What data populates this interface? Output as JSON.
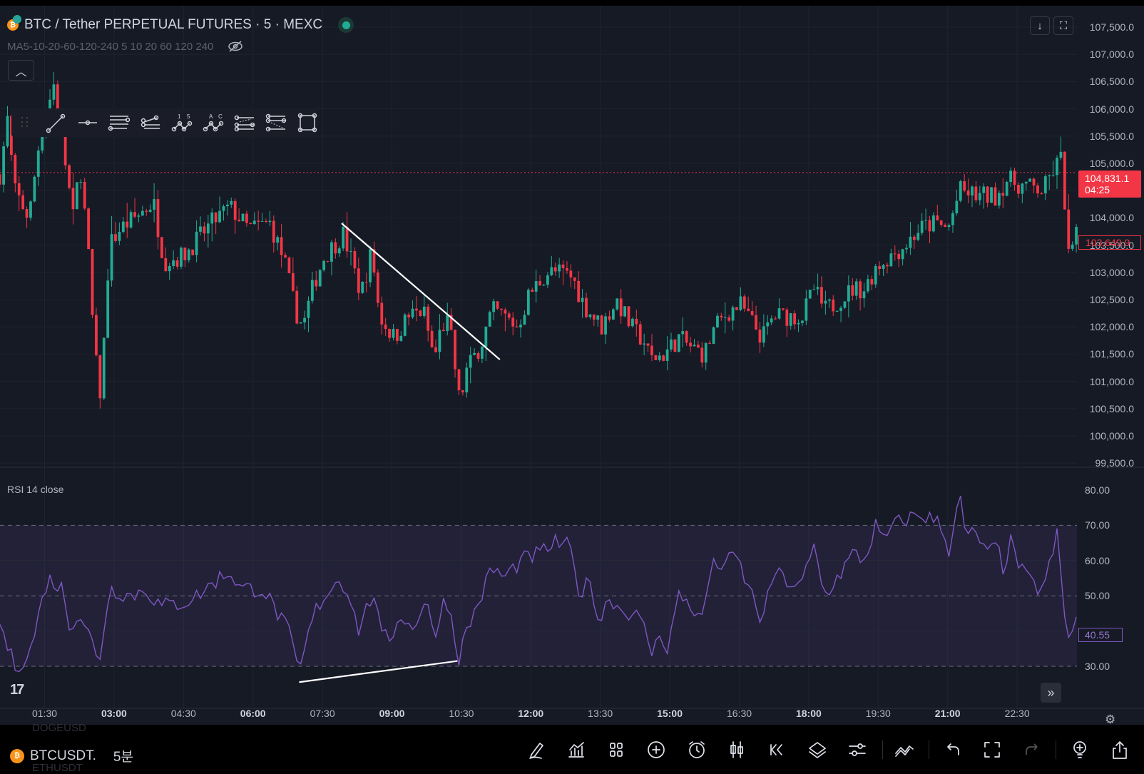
{
  "header": {
    "title": "BTC / Tether PERPETUAL FUTURES · 5 · MEXC",
    "indicator": "MA5-10-20-60-120-240 5 10 20 60 120 240"
  },
  "price_axis": [
    "107,500.0",
    "107,000.0",
    "106,500.0",
    "106,000.0",
    "105,500.0",
    "105,000.0",
    "104,500.0",
    "104,000.0",
    "103,500.0",
    "103,000.0",
    "102,500.0",
    "102,000.0",
    "101,500.0",
    "101,000.0",
    "100,500.0",
    "100,000.0",
    "99,500.0"
  ],
  "current_price": {
    "value": "104,831.1",
    "countdown": "04:25"
  },
  "last_price": "103,649.9",
  "rsi": {
    "title": "RSI 14 close",
    "axis": [
      "80.00",
      "70.00",
      "60.00",
      "50.00",
      "30.00"
    ],
    "value": "40.55"
  },
  "time_axis": [
    {
      "t": "01:30",
      "bold": false
    },
    {
      "t": "03:00",
      "bold": true
    },
    {
      "t": "04:30",
      "bold": false
    },
    {
      "t": "06:00",
      "bold": true
    },
    {
      "t": "07:30",
      "bold": false
    },
    {
      "t": "09:00",
      "bold": true
    },
    {
      "t": "10:30",
      "bold": false
    },
    {
      "t": "12:00",
      "bold": true
    },
    {
      "t": "13:30",
      "bold": false
    },
    {
      "t": "15:00",
      "bold": true
    },
    {
      "t": "16:30",
      "bold": false
    },
    {
      "t": "18:00",
      "bold": true
    },
    {
      "t": "19:30",
      "bold": false
    },
    {
      "t": "21:00",
      "bold": true
    },
    {
      "t": "22:30",
      "bold": false
    }
  ],
  "bottom": {
    "symbol": "BTCUSDT.",
    "interval": "5분",
    "prev_symbol": "DOGEUSD",
    "next_symbol": "ETHUSDT"
  },
  "colors": {
    "up": "#22ab94",
    "down": "#f23645",
    "rsi": "#7e57c2",
    "bg": "#161a25"
  },
  "chart_data": {
    "type": "candlestick",
    "interval_minutes": 5,
    "price_keypoints_min_price": [
      [
        32,
        104800
      ],
      [
        42,
        105800
      ],
      [
        51,
        104500
      ],
      [
        70,
        104000
      ],
      [
        84,
        105500
      ],
      [
        103,
        106500
      ],
      [
        117,
        105000
      ],
      [
        127,
        104000
      ],
      [
        136,
        105000
      ],
      [
        146,
        103500
      ],
      [
        155,
        101500
      ],
      [
        163,
        100700
      ],
      [
        174,
        103500
      ],
      [
        188,
        103800
      ],
      [
        207,
        104000
      ],
      [
        231,
        104300
      ],
      [
        245,
        103200
      ],
      [
        269,
        103300
      ],
      [
        288,
        103600
      ],
      [
        306,
        103900
      ],
      [
        330,
        104200
      ],
      [
        354,
        103800
      ],
      [
        382,
        103900
      ],
      [
        401,
        103200
      ],
      [
        415,
        102300
      ],
      [
        425,
        102000
      ],
      [
        439,
        102800
      ],
      [
        453,
        103300
      ],
      [
        477,
        103700
      ],
      [
        486,
        103300
      ],
      [
        500,
        102600
      ],
      [
        514,
        103400
      ],
      [
        524,
        102200
      ],
      [
        543,
        101800
      ],
      [
        562,
        102200
      ],
      [
        581,
        102300
      ],
      [
        595,
        101400
      ],
      [
        604,
        102000
      ],
      [
        614,
        102100
      ],
      [
        628,
        100600
      ],
      [
        637,
        101200
      ],
      [
        656,
        101700
      ],
      [
        670,
        102300
      ],
      [
        685,
        102200
      ],
      [
        703,
        102000
      ],
      [
        718,
        102600
      ],
      [
        741,
        103000
      ],
      [
        760,
        103000
      ],
      [
        774,
        102900
      ],
      [
        789,
        102400
      ],
      [
        812,
        102000
      ],
      [
        831,
        102500
      ],
      [
        850,
        102000
      ],
      [
        869,
        101700
      ],
      [
        874,
        101400
      ],
      [
        893,
        101500
      ],
      [
        912,
        101800
      ],
      [
        930,
        101600
      ],
      [
        945,
        101500
      ],
      [
        959,
        102000
      ],
      [
        978,
        102300
      ],
      [
        992,
        102400
      ],
      [
        1006,
        102100
      ],
      [
        1020,
        101800
      ],
      [
        1035,
        102200
      ],
      [
        1053,
        102200
      ],
      [
        1072,
        102200
      ],
      [
        1087,
        102700
      ],
      [
        1101,
        102300
      ],
      [
        1120,
        102500
      ],
      [
        1138,
        102700
      ],
      [
        1153,
        102700
      ],
      [
        1167,
        103100
      ],
      [
        1186,
        103300
      ],
      [
        1205,
        103500
      ],
      [
        1224,
        103800
      ],
      [
        1243,
        103900
      ],
      [
        1261,
        103800
      ],
      [
        1276,
        104500
      ],
      [
        1299,
        104400
      ],
      [
        1323,
        104400
      ],
      [
        1337,
        104700
      ],
      [
        1356,
        104600
      ],
      [
        1384,
        104500
      ],
      [
        1398,
        104900
      ],
      [
        1408,
        105100
      ],
      [
        1413,
        104100
      ],
      [
        1417,
        103300
      ],
      [
        1427,
        103650
      ]
    ],
    "rsi_keypoints_min_value": [
      [
        32,
        42
      ],
      [
        51,
        30
      ],
      [
        70,
        33
      ],
      [
        94,
        55
      ],
      [
        113,
        52
      ],
      [
        122,
        42
      ],
      [
        136,
        45
      ],
      [
        150,
        38
      ],
      [
        160,
        30
      ],
      [
        174,
        52
      ],
      [
        203,
        50
      ],
      [
        221,
        52
      ],
      [
        240,
        47
      ],
      [
        269,
        48
      ],
      [
        288,
        50
      ],
      [
        316,
        55
      ],
      [
        330,
        57
      ],
      [
        344,
        52
      ],
      [
        373,
        52
      ],
      [
        392,
        45
      ],
      [
        406,
        40
      ],
      [
        420,
        28
      ],
      [
        439,
        45
      ],
      [
        453,
        50
      ],
      [
        472,
        55
      ],
      [
        486,
        50
      ],
      [
        496,
        40
      ],
      [
        505,
        45
      ],
      [
        519,
        52
      ],
      [
        524,
        38
      ],
      [
        538,
        38
      ],
      [
        552,
        45
      ],
      [
        566,
        40
      ],
      [
        585,
        50
      ],
      [
        595,
        36
      ],
      [
        604,
        48
      ],
      [
        614,
        48
      ],
      [
        626,
        32
      ],
      [
        637,
        40
      ],
      [
        656,
        50
      ],
      [
        670,
        58
      ],
      [
        685,
        55
      ],
      [
        694,
        57
      ],
      [
        708,
        60
      ],
      [
        732,
        62
      ],
      [
        751,
        65
      ],
      [
        770,
        64
      ],
      [
        784,
        50
      ],
      [
        798,
        55
      ],
      [
        808,
        42
      ],
      [
        822,
        50
      ],
      [
        836,
        46
      ],
      [
        855,
        45
      ],
      [
        869,
        40
      ],
      [
        878,
        33
      ],
      [
        888,
        40
      ],
      [
        897,
        35
      ],
      [
        912,
        50
      ],
      [
        926,
        48
      ],
      [
        940,
        42
      ],
      [
        954,
        58
      ],
      [
        978,
        60
      ],
      [
        987,
        61
      ],
      [
        997,
        55
      ],
      [
        1011,
        48
      ],
      [
        1020,
        42
      ],
      [
        1035,
        57
      ],
      [
        1053,
        54
      ],
      [
        1068,
        52
      ],
      [
        1082,
        60
      ],
      [
        1086,
        65
      ],
      [
        1101,
        50
      ],
      [
        1120,
        56
      ],
      [
        1138,
        62
      ],
      [
        1153,
        60
      ],
      [
        1167,
        70
      ],
      [
        1176,
        65
      ],
      [
        1190,
        70
      ],
      [
        1209,
        72
      ],
      [
        1224,
        73
      ],
      [
        1238,
        72
      ],
      [
        1252,
        70
      ],
      [
        1261,
        62
      ],
      [
        1276,
        80
      ],
      [
        1280,
        68
      ],
      [
        1299,
        67
      ],
      [
        1313,
        61
      ],
      [
        1323,
        65
      ],
      [
        1332,
        58
      ],
      [
        1342,
        65
      ],
      [
        1356,
        57
      ],
      [
        1375,
        52
      ],
      [
        1386,
        53
      ],
      [
        1403,
        68
      ],
      [
        1411,
        45
      ],
      [
        1415,
        37
      ],
      [
        1427,
        44
      ],
      [
        1430,
        40.55
      ]
    ],
    "price_range": [
      99500,
      107500
    ],
    "rsi_range": [
      30,
      80
    ],
    "rsi_bands": [
      30,
      50,
      70
    ],
    "trendlines": {
      "price": [
        [
          475,
          103900
        ],
        [
          680,
          101400
        ]
      ],
      "rsi": [
        [
          420,
          25.5
        ],
        [
          625,
          31.5
        ]
      ]
    }
  }
}
